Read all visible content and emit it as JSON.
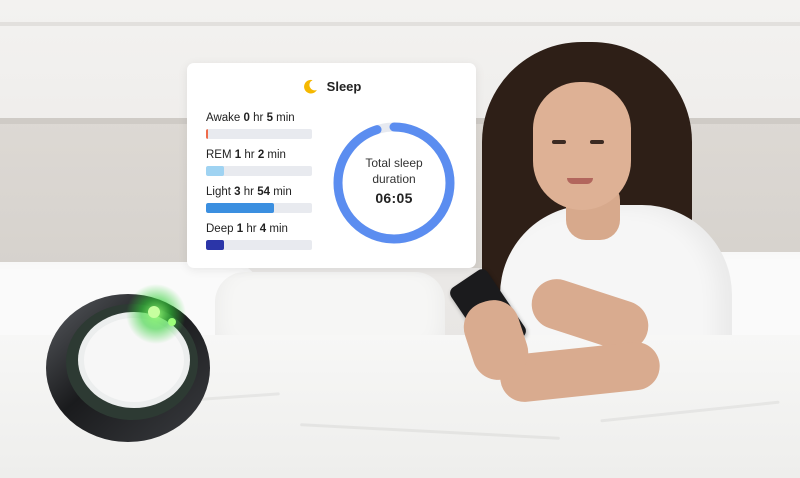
{
  "sleep_card": {
    "title": "Sleep",
    "icon": "moon-icon",
    "stages": [
      {
        "name": "Awake",
        "hours": "0",
        "hr_unit": "hr",
        "minutes": "5",
        "min_unit": "min",
        "fill_fraction": 0.02,
        "color": "#ef6b4a"
      },
      {
        "name": "REM",
        "hours": "1",
        "hr_unit": "hr",
        "minutes": "2",
        "min_unit": "min",
        "fill_fraction": 0.17,
        "color": "#9fd3f2"
      },
      {
        "name": "Light",
        "hours": "3",
        "hr_unit": "hr",
        "minutes": "54",
        "min_unit": "min",
        "fill_fraction": 0.64,
        "color": "#3b8fe0"
      },
      {
        "name": "Deep",
        "hours": "1",
        "hr_unit": "hr",
        "minutes": "4",
        "min_unit": "min",
        "fill_fraction": 0.17,
        "color": "#2b35a8"
      }
    ],
    "total_label_line1": "Total sleep",
    "total_label_line2": "duration",
    "total_value": "06:05",
    "ring_fraction": 0.95,
    "ring_color": "#5b8df0",
    "ring_track_color": "#e6e9f0"
  }
}
